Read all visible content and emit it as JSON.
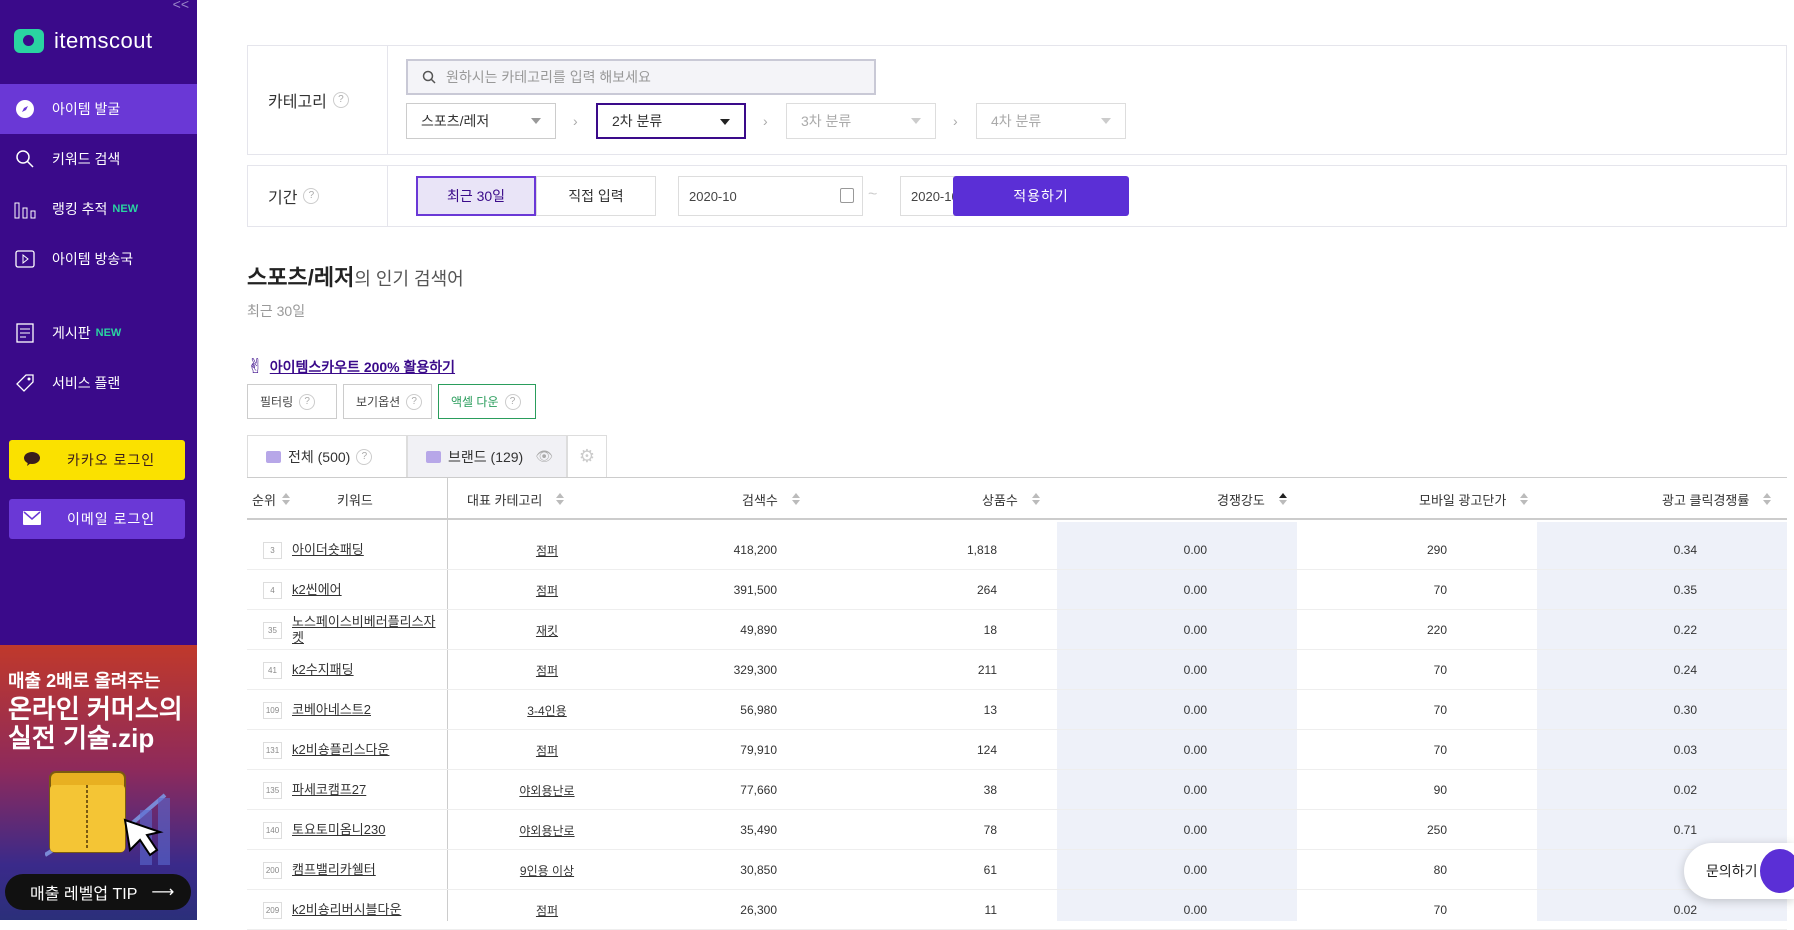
{
  "app": {
    "name": "itemscout",
    "collapse": "<<"
  },
  "sidebar": {
    "items": [
      {
        "label": "아이템 발굴",
        "icon": "compass-icon",
        "active": true,
        "badge": ""
      },
      {
        "label": "키워드 검색",
        "icon": "search-icon",
        "active": false,
        "badge": ""
      },
      {
        "label": "랭킹 추적",
        "icon": "bar-chart-icon",
        "active": false,
        "badge": "NEW"
      },
      {
        "label": "아이템 방송국",
        "icon": "play-icon",
        "active": false,
        "badge": ""
      },
      {
        "label": "게시판",
        "icon": "document-icon",
        "active": false,
        "badge": "NEW"
      },
      {
        "label": "서비스 플랜",
        "icon": "tag-icon",
        "active": false,
        "badge": ""
      }
    ],
    "kakao_login": "카카오 로그인",
    "email_login": "이메일 로그인",
    "banner": {
      "line1": "매출 2배로 올려주는",
      "line2": "온라인 커머스의",
      "line3": "실전 기술.zip",
      "tip": "매출 레벨업 TIP"
    }
  },
  "filters": {
    "category_label": "카테고리",
    "help": "?",
    "search_placeholder": "원하시는 카테고리를 입력 해보세요",
    "selects": [
      "스포츠/레저",
      "2차 분류",
      "3차 분류",
      "4차 분류"
    ],
    "period_label": "기간",
    "period_buttons": [
      "최근 30일",
      "직접 입력"
    ],
    "date_from": "2020-10",
    "date_to": "2020-10",
    "apply": "적용하기"
  },
  "heading": {
    "category": "스포츠/레저",
    "suffix": "의 인기 검색어",
    "subtitle": "최근 30일"
  },
  "promo": {
    "emoji": "✌",
    "link": "아이템스카우트 200% 활용하기"
  },
  "options": [
    "필터링",
    "보기옵션",
    "액셀 다운"
  ],
  "tabs": [
    {
      "label": "전체 (500)"
    },
    {
      "label": "브랜드 (129)"
    }
  ],
  "table": {
    "columns": [
      "순위",
      "키워드",
      "대표 카테고리",
      "검색수",
      "상품수",
      "경쟁강도",
      "모바일 광고단가",
      "광고 클릭경쟁률"
    ],
    "rows": [
      {
        "rank": "3",
        "keyword": "아이더숏패딩",
        "category": "점퍼",
        "search": "418,200",
        "products": "1,818",
        "competition": "0.00",
        "mobile_cpc": "290",
        "click": "0.34"
      },
      {
        "rank": "4",
        "keyword": "k2씬에어",
        "category": "점퍼",
        "search": "391,500",
        "products": "264",
        "competition": "0.00",
        "mobile_cpc": "70",
        "click": "0.35"
      },
      {
        "rank": "35",
        "keyword": "노스페이스비베러플리스자켓",
        "category": "재킷",
        "search": "49,890",
        "products": "18",
        "competition": "0.00",
        "mobile_cpc": "220",
        "click": "0.22"
      },
      {
        "rank": "41",
        "keyword": "k2수지패딩",
        "category": "점퍼",
        "search": "329,300",
        "products": "211",
        "competition": "0.00",
        "mobile_cpc": "70",
        "click": "0.24"
      },
      {
        "rank": "109",
        "keyword": "코베아네스트2",
        "category": "3-4인용",
        "search": "56,980",
        "products": "13",
        "competition": "0.00",
        "mobile_cpc": "70",
        "click": "0.30"
      },
      {
        "rank": "131",
        "keyword": "k2비숑플리스다운",
        "category": "점퍼",
        "search": "79,910",
        "products": "124",
        "competition": "0.00",
        "mobile_cpc": "70",
        "click": "0.03"
      },
      {
        "rank": "135",
        "keyword": "파세코캠프27",
        "category": "야외용난로",
        "search": "77,660",
        "products": "38",
        "competition": "0.00",
        "mobile_cpc": "90",
        "click": "0.02"
      },
      {
        "rank": "140",
        "keyword": "토요토미옴니230",
        "category": "야외용난로",
        "search": "35,490",
        "products": "78",
        "competition": "0.00",
        "mobile_cpc": "250",
        "click": "0.71"
      },
      {
        "rank": "200",
        "keyword": "캠프밸리카쉘터",
        "category": "9인용 이상",
        "search": "30,850",
        "products": "61",
        "competition": "0.00",
        "mobile_cpc": "80",
        "click": ""
      },
      {
        "rank": "209",
        "keyword": "k2비숑리버시블다운",
        "category": "점퍼",
        "search": "26,300",
        "products": "11",
        "competition": "0.00",
        "mobile_cpc": "70",
        "click": "0.02"
      }
    ]
  },
  "inquiry": "문의하기",
  "colors": {
    "sidebar": "#3a0a8a",
    "active": "#6a38d6",
    "accent": "#5b2fd6",
    "mint": "#2ad4a1",
    "kakao": "#fae100"
  }
}
